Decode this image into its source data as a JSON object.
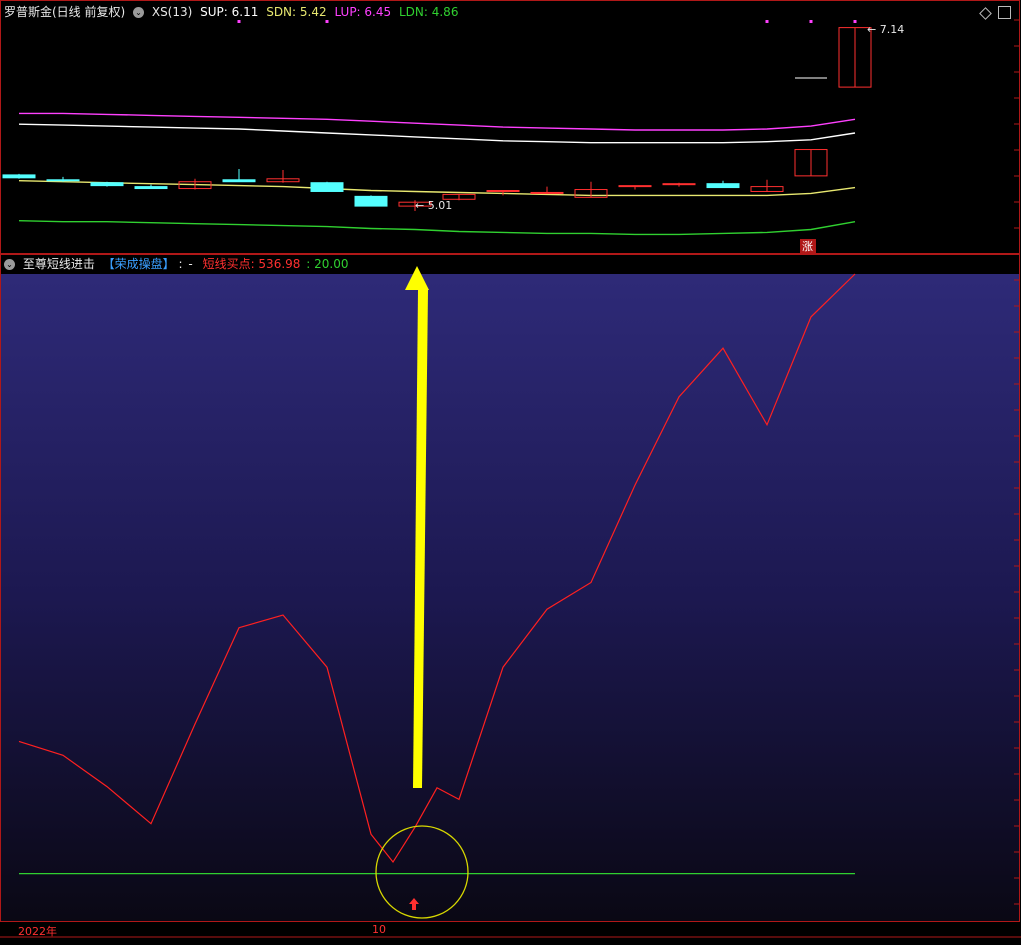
{
  "top_header": {
    "title": "罗普斯金(日线 前复权)",
    "indicator": "XS(13)",
    "sup_label": "SUP: 6.11",
    "sdn_label": "SDN: 5.42",
    "lup_label": "LUP: 6.45",
    "ldn_label": "LDN: 4.86"
  },
  "price_labels": {
    "high": "7.14",
    "low": "5.01",
    "limit_up_badge": "涨"
  },
  "bottom_header": {
    "indicator": "至尊短线进击",
    "brand": "【荣成操盘】",
    "sep": ":",
    "dash": "-",
    "signal_label": "短线买点: 536.98",
    "line_value": ": 20.00"
  },
  "timeline": {
    "year_label": "2022年",
    "month_label": "10"
  },
  "colors": {
    "up": "#ff3030",
    "down": "#54ffff",
    "lup": "#ff40ff",
    "sup": "#ffffff",
    "mid": "#e8e870",
    "ldn": "#30d030",
    "signal_line": "#ff2020",
    "arrow": "#ffff00",
    "circle": "#d8d800"
  },
  "chart_data": [
    {
      "type": "candlestick",
      "title": "罗普斯金(日线 前复权)",
      "bands": {
        "LUP": [
          6.26,
          6.26,
          6.25,
          6.24,
          6.23,
          6.22,
          6.21,
          6.2,
          6.18,
          6.16,
          6.14,
          6.12,
          6.11,
          6.1,
          6.09,
          6.09,
          6.09,
          6.1,
          6.13,
          6.2
        ],
        "SUP": [
          6.15,
          6.14,
          6.13,
          6.12,
          6.11,
          6.1,
          6.08,
          6.06,
          6.04,
          6.02,
          6,
          5.98,
          5.97,
          5.96,
          5.96,
          5.96,
          5.96,
          5.97,
          5.99,
          6.06
        ],
        "MID": [
          5.57,
          5.56,
          5.55,
          5.54,
          5.53,
          5.52,
          5.51,
          5.49,
          5.47,
          5.46,
          5.45,
          5.44,
          5.43,
          5.42,
          5.42,
          5.42,
          5.42,
          5.42,
          5.44,
          5.5
        ],
        "LDN": [
          5.16,
          5.15,
          5.15,
          5.14,
          5.13,
          5.12,
          5.11,
          5.1,
          5.08,
          5.07,
          5.05,
          5.04,
          5.03,
          5.03,
          5.02,
          5.02,
          5.03,
          5.04,
          5.07,
          5.15
        ]
      },
      "ohlc": [
        [
          5.63,
          5.64,
          5.59,
          5.6
        ],
        [
          5.58,
          5.61,
          5.56,
          5.57
        ],
        [
          5.55,
          5.56,
          5.51,
          5.52
        ],
        [
          5.51,
          5.53,
          5.49,
          5.49
        ],
        [
          5.49,
          5.59,
          5.48,
          5.56
        ],
        [
          5.58,
          5.69,
          5.56,
          5.56
        ],
        [
          5.56,
          5.68,
          5.55,
          5.59
        ],
        [
          5.55,
          5.56,
          5.46,
          5.46
        ],
        [
          5.41,
          5.42,
          5.31,
          5.31
        ],
        [
          5.31,
          5.37,
          5.26,
          5.35
        ],
        [
          5.38,
          5.43,
          5.37,
          5.43
        ],
        [
          5.47,
          5.47,
          5.42,
          5.47
        ],
        [
          5.44,
          5.51,
          5.44,
          5.45
        ],
        [
          5.4,
          5.56,
          5.4,
          5.48
        ],
        [
          5.52,
          5.52,
          5.48,
          5.52
        ],
        [
          5.53,
          5.55,
          5.51,
          5.54
        ],
        [
          5.54,
          5.57,
          5.5,
          5.5
        ],
        [
          5.46,
          5.58,
          5.46,
          5.51
        ],
        [
          5.62,
          5.89,
          5.62,
          5.89
        ],
        [
          6.53,
          7.14,
          6.53,
          7.14
        ]
      ],
      "annotations": {
        "high_price": 7.14,
        "low_price": 5.01,
        "limit_up_day_index": 19
      }
    },
    {
      "type": "line",
      "title": "至尊短线进击",
      "series": [
        {
          "name": "短线买点",
          "values": [
            134,
            122,
            95,
            63,
            149,
            232,
            243,
            198,
            54,
            60,
            84,
            198,
            248,
            271,
            355,
            431,
            473,
            407,
            500,
            536.98
          ]
        },
        {
          "values": [
            20,
            20,
            20,
            20,
            20,
            20,
            20,
            20,
            20,
            20,
            20,
            20,
            20,
            20,
            20,
            20,
            20,
            20,
            20,
            20
          ]
        }
      ],
      "extra_points": [
        {
          "x": 8.5,
          "y": 30
        },
        {
          "x": 9.5,
          "y": 94
        }
      ],
      "ylim": [
        0,
        536.98
      ],
      "grid": false
    }
  ]
}
